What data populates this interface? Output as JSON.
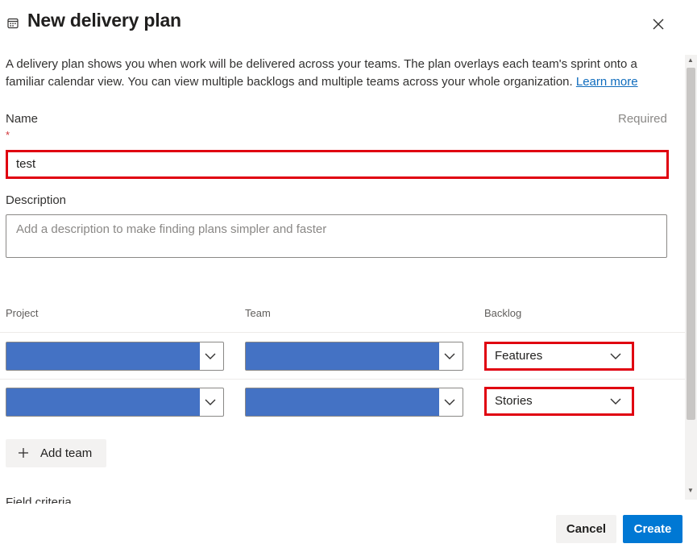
{
  "dialog": {
    "title": "New delivery plan",
    "title_icon": "calendar-icon",
    "close_icon": "close-icon"
  },
  "intro": {
    "text": "A delivery plan shows you when work will be delivered across your teams. The plan overlays each team's sprint onto a familiar calendar view. You can view multiple backlogs and multiple teams across your whole organization.",
    "link": "Learn more"
  },
  "name_field": {
    "label": "Name",
    "required_text": "Required",
    "asterisk": "*",
    "value": "test"
  },
  "description_field": {
    "label": "Description",
    "placeholder": "Add a description to make finding plans simpler and faster"
  },
  "teams_table": {
    "headers": {
      "project": "Project",
      "team": "Team",
      "backlog": "Backlog"
    },
    "rows": [
      {
        "project": "",
        "team": "",
        "backlog": "Features"
      },
      {
        "project": "",
        "team": "",
        "backlog": "Stories"
      }
    ],
    "redacted_color": "#4472c4"
  },
  "add_team": {
    "label": "Add team",
    "icon": "plus-icon"
  },
  "partially_visible_section": {
    "label": "Field criteria"
  },
  "footer": {
    "cancel_label": "Cancel",
    "create_label": "Create",
    "primary_color": "#0078d4"
  },
  "highlight_color": "#e00010"
}
